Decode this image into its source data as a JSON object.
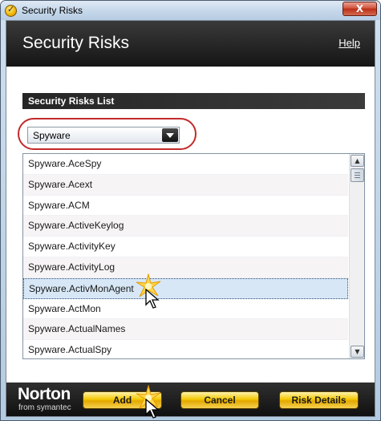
{
  "window": {
    "title": "Security Risks",
    "close_glyph": "X"
  },
  "header": {
    "title": "Security Risks",
    "help_label": "Help"
  },
  "section": {
    "title": "Security Risks List"
  },
  "dropdown": {
    "selected": "Spyware"
  },
  "list": {
    "items": [
      "Spyware.AceSpy",
      "Spyware.Acext",
      "Spyware.ACM",
      "Spyware.ActiveKeylog",
      "Spyware.ActivityKey",
      "Spyware.ActivityLog",
      "Spyware.ActivMonAgent",
      "Spyware.ActMon",
      "Spyware.ActualNames",
      "Spyware.ActualSpy"
    ],
    "selected_index": 6
  },
  "footer": {
    "logo_main": "Norton",
    "logo_sub": "from symantec",
    "add_label": "Add",
    "cancel_label": "Cancel",
    "risk_details_label": "Risk Details"
  },
  "colors": {
    "header_bg": "#1e1e1e",
    "button_gold": "#f3c800",
    "highlight_ring": "#c22a2a",
    "selected_row": "#d7e7f6"
  }
}
